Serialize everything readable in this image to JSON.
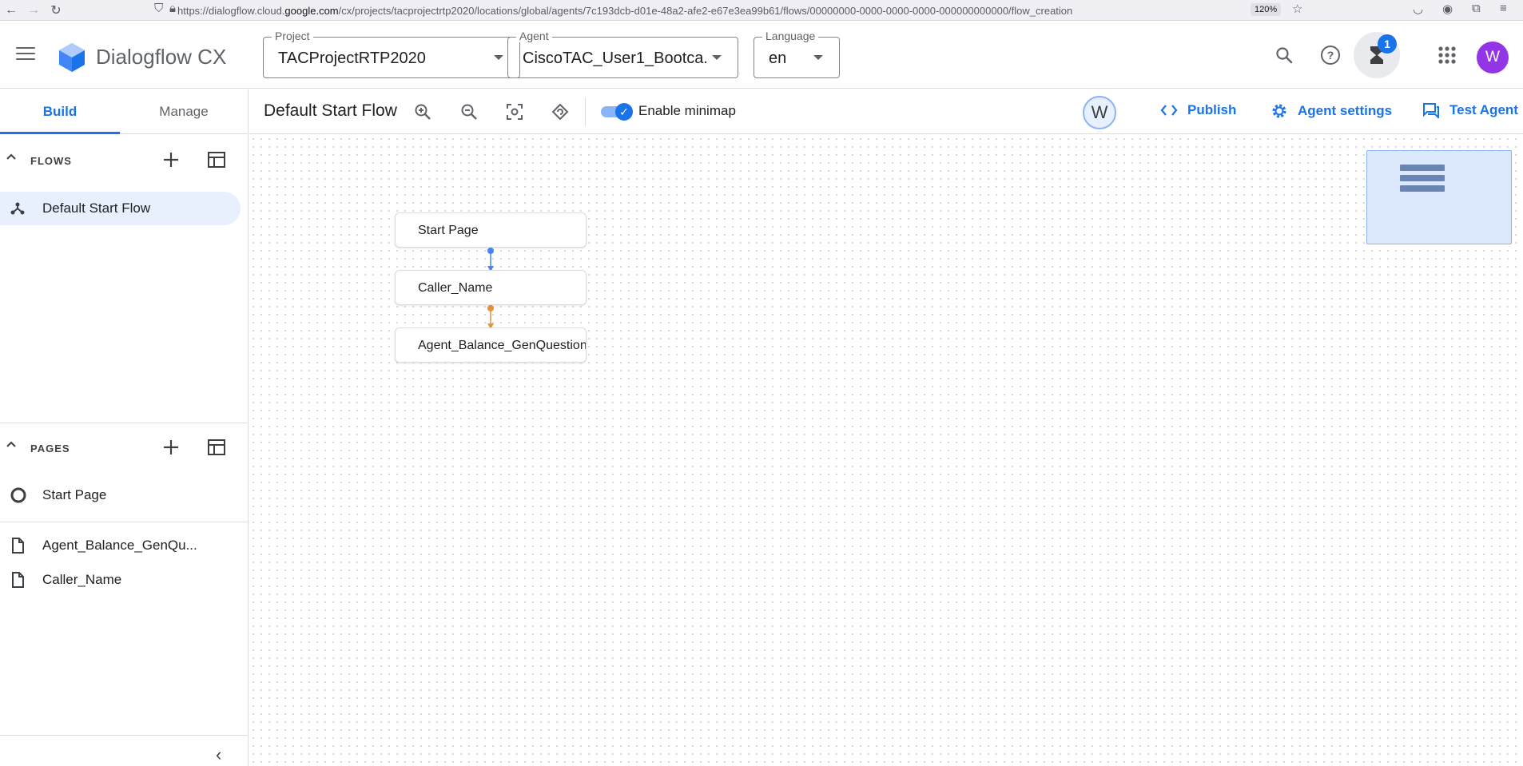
{
  "browser": {
    "url_prefix": "https://dialogflow.cloud.",
    "url_domain": "google.com",
    "url_suffix": "/cx/projects/tacprojectrtp2020/locations/global/agents/7c193dcb-d01e-48a2-afe2-e67e3ea99b61/flows/00000000-0000-0000-0000-000000000000/flow_creation",
    "zoom": "120%"
  },
  "header": {
    "product_name": "Dialogflow CX",
    "project": {
      "label": "Project",
      "value": "TACProjectRTP2020"
    },
    "agent": {
      "label": "Agent",
      "value": "CiscoTAC_User1_Bootca..."
    },
    "language": {
      "label": "Language",
      "value": "en"
    },
    "notification_count": "1",
    "avatar_initial": "W",
    "brand_color": "#1a73e8",
    "avatar_color": "#9334e6"
  },
  "sidebar": {
    "tabs": [
      {
        "label": "Build",
        "active": true
      },
      {
        "label": "Manage",
        "active": false
      }
    ],
    "flows_title": "FLOWS",
    "flows": [
      {
        "label": "Default Start Flow",
        "selected": true
      }
    ],
    "pages_title": "PAGES",
    "start_page": "Start Page",
    "pages": [
      {
        "label": "Agent_Balance_GenQu..."
      },
      {
        "label": "Caller_Name"
      }
    ]
  },
  "toolbar": {
    "flow_title": "Default Start Flow",
    "minimap_toggle_label": "Enable minimap",
    "minimap_enabled": true,
    "collaborator_initial": "W",
    "publish_label": "Publish",
    "agent_settings_label": "Agent settings",
    "test_agent_label": "Test Agent"
  },
  "canvas": {
    "nodes": [
      {
        "label": "Start Page"
      },
      {
        "label": "Caller_Name"
      },
      {
        "label": "Agent_Balance_GenQuestion"
      }
    ],
    "edges": [
      {
        "from": "Start Page",
        "to": "Caller_Name",
        "color": "#4285f4"
      },
      {
        "from": "Caller_Name",
        "to": "Agent_Balance_GenQuestion",
        "color": "#e8903a"
      }
    ]
  }
}
